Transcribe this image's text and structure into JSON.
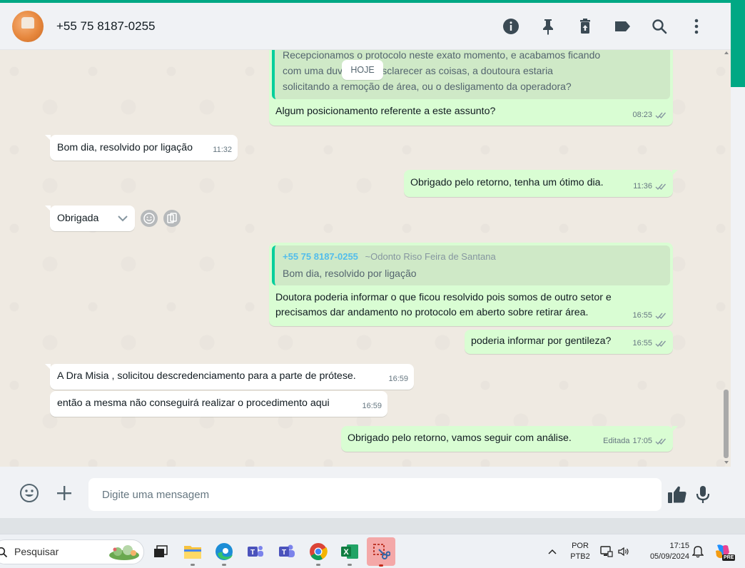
{
  "header": {
    "contact_name": "+55 75 8187-0255",
    "actions": [
      "info-icon",
      "pin-icon",
      "delete-icon",
      "label-icon",
      "search-icon",
      "more-options-icon"
    ]
  },
  "chat": {
    "date_chip": "HOJE",
    "messages": [
      {
        "direction": "outgoing",
        "quote_lines": [
          "Recepcionamos o protocolo neste exato momento, e acabamos ficando",
          "com uma duv       o para esclarecer as coisas, a doutoura estaria",
          "solicitando a remoção de área, ou o desligamento da operadora?"
        ],
        "text": "Algum posicionamento referente a este assunto?",
        "time": "08:23"
      },
      {
        "direction": "incoming",
        "text": "Bom dia, resolvido por ligação",
        "time": "11:32"
      },
      {
        "direction": "outgoing",
        "text": "Obrigado pelo retorno, tenha um ótimo dia.",
        "time": "11:36"
      },
      {
        "direction": "incoming",
        "text": "Obrigada"
      },
      {
        "direction": "outgoing",
        "quote_author": "+55 75 8187-0255",
        "quote_pushname": "~Odonto Riso Feira de Santana",
        "quote_text": "Bom dia, resolvido por ligação",
        "text_lines": [
          "Doutora poderia informar o que ficou resolvido pois somos de outro setor e",
          "precisamos dar andamento no protocolo em aberto sobre retirar área."
        ],
        "time": "16:55"
      },
      {
        "direction": "outgoing",
        "text": "poderia informar por gentileza?",
        "time": "16:55"
      },
      {
        "direction": "incoming",
        "text": "A Dra Misia , solicitou descredenciamento para a parte de prótese.",
        "time": "16:59"
      },
      {
        "direction": "incoming",
        "text": "então a mesma não conseguirá realizar o procedimento aqui",
        "time": "16:59"
      },
      {
        "direction": "outgoing",
        "text": "Obrigado pelo retorno, vamos seguir com análise.",
        "edited_label": "Editada",
        "time": "17:05"
      }
    ]
  },
  "composer": {
    "placeholder": "Digite uma mensagem"
  },
  "taskbar": {
    "search_placeholder": "Pesquisar",
    "language_line1": "POR",
    "language_line2": "PTB2",
    "clock_time": "17:15",
    "clock_date": "05/09/2024",
    "copilot_badge": "PRE"
  },
  "colors": {
    "accent": "#00a884",
    "outgoing_bubble": "#d9fdd3",
    "incoming_bubble": "#ffffff",
    "chat_background": "#efeae2",
    "quote_author": "#53bdeb"
  }
}
